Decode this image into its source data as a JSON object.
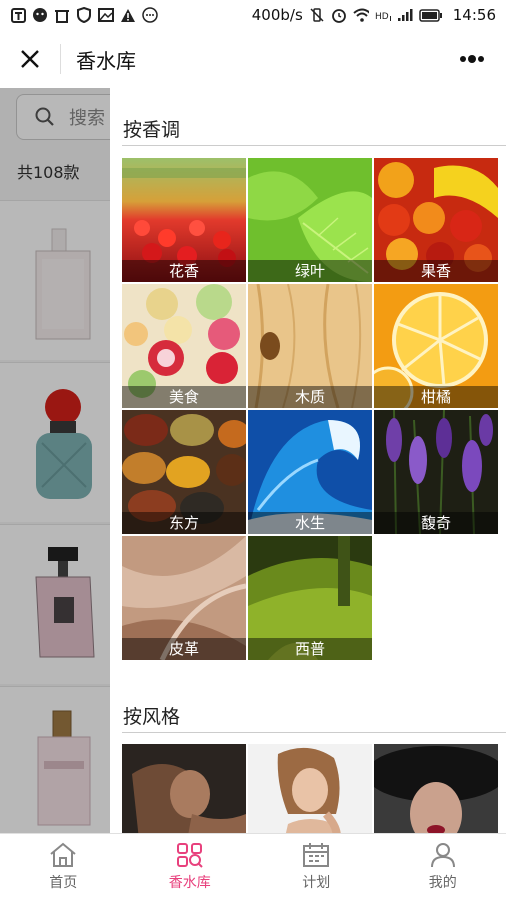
{
  "status_bar": {
    "net_speed": "400b/s",
    "time": "14:56"
  },
  "header": {
    "title": "香水库"
  },
  "list": {
    "search_placeholder": "搜索",
    "count_text": "共108款"
  },
  "sections": [
    {
      "title": "按香调",
      "tiles": [
        {
          "label": "花香",
          "icon": "tulip-field-photo"
        },
        {
          "label": "绿叶",
          "icon": "green-leaves-photo"
        },
        {
          "label": "果香",
          "icon": "fruit-assortment-photo"
        },
        {
          "label": "美食",
          "icon": "desserts-photo"
        },
        {
          "label": "木质",
          "icon": "wood-grain-photo"
        },
        {
          "label": "柑橘",
          "icon": "orange-slices-photo"
        },
        {
          "label": "东方",
          "icon": "spices-photo"
        },
        {
          "label": "水生",
          "icon": "ocean-wave-photo"
        },
        {
          "label": "馥奇",
          "icon": "lavender-photo"
        },
        {
          "label": "皮革",
          "icon": "leather-photo"
        },
        {
          "label": "西普",
          "icon": "moss-photo"
        }
      ]
    },
    {
      "title": "按风格",
      "tiles": [
        {
          "label": "",
          "icon": "sensual-woman-photo"
        },
        {
          "label": "",
          "icon": "elegant-woman-photo"
        },
        {
          "label": "",
          "icon": "woman-black-hat-photo"
        }
      ]
    }
  ],
  "bottom_nav": [
    {
      "label": "首页",
      "icon": "home-icon",
      "active": false
    },
    {
      "label": "香水库",
      "icon": "perfume-library-icon",
      "active": true
    },
    {
      "label": "计划",
      "icon": "calendar-icon",
      "active": false
    },
    {
      "label": "我的",
      "icon": "user-icon",
      "active": false
    }
  ],
  "colors": {
    "accent": "#e8417d",
    "inactive": "#666666"
  }
}
